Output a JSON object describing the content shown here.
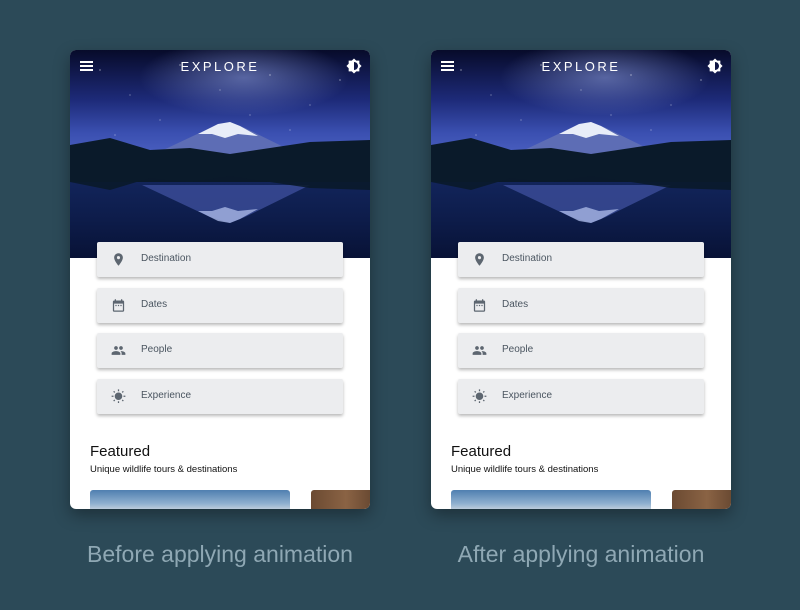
{
  "panels": [
    {
      "app_title": "EXPLORE",
      "fields": [
        {
          "label": "Destination",
          "icon": "location-pin-icon"
        },
        {
          "label": "Dates",
          "icon": "calendar-icon"
        },
        {
          "label": "People",
          "icon": "people-icon"
        },
        {
          "label": "Experience",
          "icon": "sun-icon"
        }
      ],
      "featured": {
        "title": "Featured",
        "subtitle": "Unique wildlife tours & destinations"
      },
      "caption": "Before applying animation"
    },
    {
      "app_title": "EXPLORE",
      "fields": [
        {
          "label": "Destination",
          "icon": "location-pin-icon"
        },
        {
          "label": "Dates",
          "icon": "calendar-icon"
        },
        {
          "label": "People",
          "icon": "people-icon"
        },
        {
          "label": "Experience",
          "icon": "sun-icon"
        }
      ],
      "featured": {
        "title": "Featured",
        "subtitle": "Unique wildlife tours & destinations"
      },
      "caption": "After applying animation"
    }
  ],
  "colors": {
    "background": "#2c4a58",
    "field_background": "#ecedef",
    "icon": "#5d6670",
    "caption": "#8fa8b4"
  }
}
